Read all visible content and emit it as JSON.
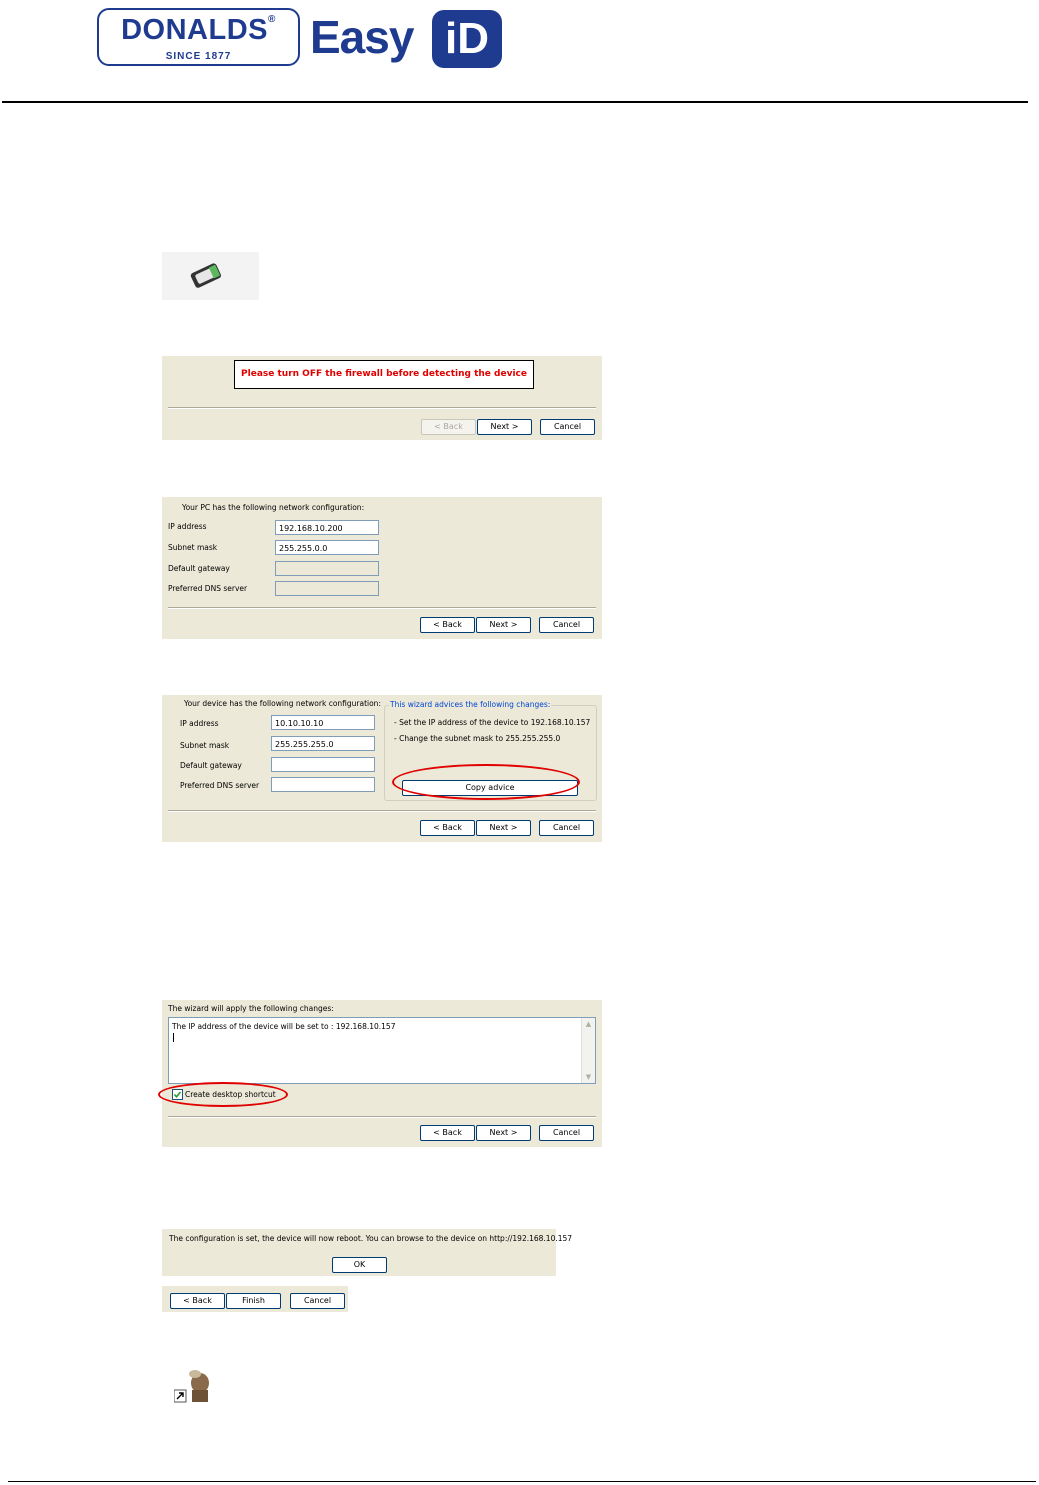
{
  "header": {
    "logo_donalds": "DONALDS",
    "logo_reg": "®",
    "logo_since": "SINCE 1877",
    "logo_easy": "Easy",
    "logo_id": "iD"
  },
  "firewall_dialog": {
    "message": "Please turn OFF the firewall before detecting the device",
    "back": "< Back",
    "next": "Next >",
    "cancel": "Cancel"
  },
  "pc_config_dialog": {
    "heading": "Your PC has the following network configuration:",
    "ip_label": "IP address",
    "ip_value": "192.168.10.200",
    "subnet_label": "Subnet mask",
    "subnet_value": "255.255.0.0",
    "gateway_label": "Default gateway",
    "dns_label": "Preferred DNS server",
    "back": "< Back",
    "next": "Next >",
    "cancel": "Cancel"
  },
  "device_config_dialog": {
    "heading": "Your device has the following network configuration:",
    "ip_label": "IP address",
    "ip_value": "10.10.10.10",
    "subnet_label": "Subnet mask",
    "subnet_value": "255.255.255.0",
    "gateway_label": "Default gateway",
    "dns_label": "Preferred DNS server",
    "advice_title": "This wizard advices the following changes:",
    "advice_1": "- Set the IP address of the device to 192.168.10.157",
    "advice_2": "- Change the subnet mask to 255.255.255.0",
    "copy_advice": "Copy advice",
    "back": "< Back",
    "next": "Next >",
    "cancel": "Cancel"
  },
  "apply_dialog": {
    "heading": "The wizard will apply the following changes:",
    "text": "The IP address of the device will be set to : 192.168.10.157",
    "checkbox_label": "Create desktop shortcut",
    "checkbox_checked": true,
    "back": "< Back",
    "next": "Next >",
    "cancel": "Cancel"
  },
  "reboot_dialog": {
    "message": "The configuration is set, the device will now reboot. You can browse to the device on http://192.168.10.157",
    "ok": "OK"
  },
  "finish_dialog": {
    "back": "< Back",
    "finish": "Finish",
    "cancel": "Cancel"
  }
}
